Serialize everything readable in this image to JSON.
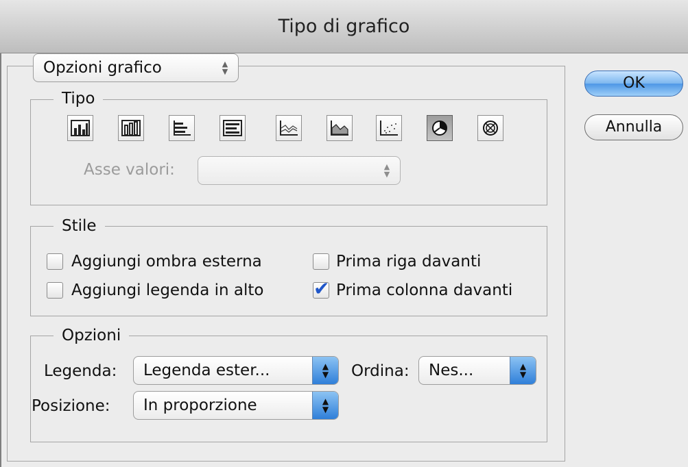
{
  "window": {
    "title": "Tipo di grafico"
  },
  "section_popup": {
    "value": "Opzioni grafico"
  },
  "type_group": {
    "legend": "Tipo",
    "buttons": [
      {
        "name": "column-chart-icon"
      },
      {
        "name": "stacked-column-chart-icon"
      },
      {
        "name": "bar-chart-icon"
      },
      {
        "name": "stacked-bar-chart-icon"
      },
      {
        "name": "line-chart-icon"
      },
      {
        "name": "area-chart-icon"
      },
      {
        "name": "scatter-chart-icon"
      },
      {
        "name": "pie-chart-icon",
        "selected": true
      },
      {
        "name": "radar-chart-icon"
      }
    ],
    "value_axis_label": "Asse valori:",
    "value_axis_value": ""
  },
  "style_group": {
    "legend": "Stile",
    "options": [
      {
        "label": "Aggiungi ombra esterna",
        "checked": false
      },
      {
        "label": "Prima riga davanti",
        "checked": false
      },
      {
        "label": "Aggiungi legenda in alto",
        "checked": false
      },
      {
        "label": "Prima colonna davanti",
        "checked": true
      }
    ]
  },
  "options_group": {
    "legend": "Opzioni",
    "legend_label": "Legenda:",
    "legend_value": "Legenda ester...",
    "sort_label": "Ordina:",
    "sort_value": "Nes...",
    "position_label": "Posizione:",
    "position_value": "In proporzione"
  },
  "buttons": {
    "ok": "OK",
    "cancel": "Annulla"
  },
  "colors": {
    "accent": "#3d86e0",
    "checkmark": "#1f56c9"
  }
}
